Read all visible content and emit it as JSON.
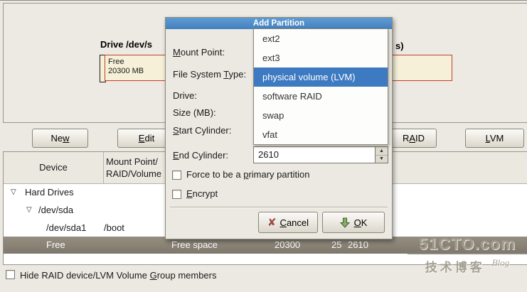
{
  "top_panel": {
    "heading_left": "Drive /dev/s",
    "heading_right": "s)",
    "bar": {
      "label_line1": "Free",
      "label_line2": "20300 MB"
    }
  },
  "toolbar": {
    "new": {
      "pre": "Ne",
      "key": "w",
      "post": ""
    },
    "edit": {
      "pre": "",
      "key": "E",
      "post": "dit"
    },
    "raid": {
      "pre": "R",
      "key": "A",
      "post": "ID"
    },
    "lvm": {
      "pre": "",
      "key": "L",
      "post": "VM"
    }
  },
  "table": {
    "headers": {
      "device": "Device",
      "mount_line1": "Mount Point/",
      "mount_line2": "RAID/Volume"
    },
    "expander_icon": "▽",
    "rows": {
      "hard_drives": "Hard Drives",
      "sda": "/dev/sda",
      "sda1_device": "/dev/sda1",
      "sda1_mount": "/boot",
      "free": {
        "device": "Free",
        "type": "Free space",
        "size": "20300",
        "start": "25",
        "end": "2610"
      }
    }
  },
  "bottom": {
    "hide_checkbox": {
      "pre": "Hide RAID device/LVM Volume ",
      "key": "G",
      "post": "roup members"
    }
  },
  "dialog": {
    "title": "Add Partition",
    "labels": {
      "mount_point": {
        "pre": "",
        "key": "M",
        "post": "ount Point:"
      },
      "fs_type": {
        "pre": "File System ",
        "key": "T",
        "post": "ype:"
      },
      "drive": "Drive:",
      "size": "Size (MB):",
      "start_cyl": {
        "pre": "",
        "key": "S",
        "post": "tart Cylinder:"
      },
      "end_cyl": {
        "pre": "",
        "key": "E",
        "post": "nd Cylinder:"
      }
    },
    "dropdown": {
      "items": [
        "ext2",
        "ext3",
        "physical volume (LVM)",
        "software RAID",
        "swap",
        "vfat"
      ],
      "selected_index": 2,
      "selected_value": "physical volume (LVM)"
    },
    "end_cylinder_value": "2610",
    "spinner": {
      "up_icon": "▲",
      "down_icon": "▼"
    },
    "checkboxes": {
      "force": {
        "pre": "Force to be a ",
        "key": "p",
        "post": "rimary partition",
        "checked": false
      },
      "encrypt": {
        "pre": "",
        "key": "E",
        "post": "ncrypt",
        "checked": false
      }
    },
    "buttons": {
      "cancel": {
        "icon": "✘",
        "pre": "",
        "key": "C",
        "post": "ancel"
      },
      "ok": {
        "pre": "",
        "key": "O",
        "post": "K"
      }
    }
  },
  "watermark": {
    "line1": "51CTO.com",
    "line2": "技术博客",
    "line3": "Blog"
  },
  "colors": {
    "background": "#ece9e2",
    "titlebar_blue": "#4a87c8",
    "highlight_blue": "#3d7ac1",
    "bar_fill": "#f6f0d8",
    "bar_border_red": "#c43c2c",
    "selected_row": "#8a8376",
    "cancel_icon_red": "#9a4a46",
    "ok_icon_green": "#86ac6a"
  }
}
